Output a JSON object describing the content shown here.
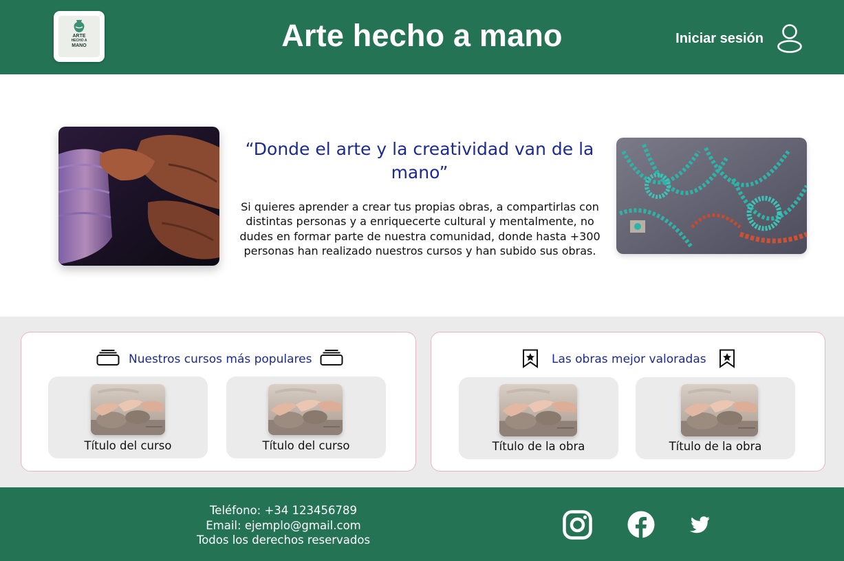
{
  "header": {
    "logo": {
      "line1": "ARTE",
      "line2": "HECHO A",
      "line3": "MANO"
    },
    "title": "Arte hecho a mano",
    "login_label": "Iniciar sesión",
    "icons": {
      "user": "user-icon"
    }
  },
  "hero": {
    "left_image": "pottery-wheel-hands-photo",
    "right_image": "turquoise-jewelry-photo",
    "quote": "“Donde el arte y la creatividad van de la mano”",
    "text": "Si quieres aprender a crear tus propias obras, a compartirlas con distintas personas y a enriquecerte cultural y mentalmente, no dudes en formar parte de nuestra comunidad, donde hasta +300 personas han realizado nuestros cursos y han subido sus obras."
  },
  "courses": {
    "title": "Nuestros cursos más populares",
    "icon": "stack-icon",
    "items": [
      {
        "title": "Título del curso",
        "image": "clay-hands-photo"
      },
      {
        "title": "Título del curso",
        "image": "clay-hands-photo"
      }
    ]
  },
  "works": {
    "title": "Las obras mejor valoradas",
    "icon": "bookmark-star-icon",
    "items": [
      {
        "title": "Título de la obra",
        "image": "clay-hands-photo"
      },
      {
        "title": "Título de la obra",
        "image": "clay-hands-photo"
      }
    ]
  },
  "footer": {
    "phone": "Teléfono: +34 123456789",
    "email": "Email: ejemplo@gmail.com",
    "rights": "Todos los derechos reservados",
    "social": [
      "instagram-icon",
      "facebook-icon",
      "twitter-icon"
    ]
  },
  "colors": {
    "brand_green": "#257355",
    "accent_blue": "#1c2b8f",
    "band_gray": "#ebebeb",
    "panel_border": "#e6b7c1"
  }
}
